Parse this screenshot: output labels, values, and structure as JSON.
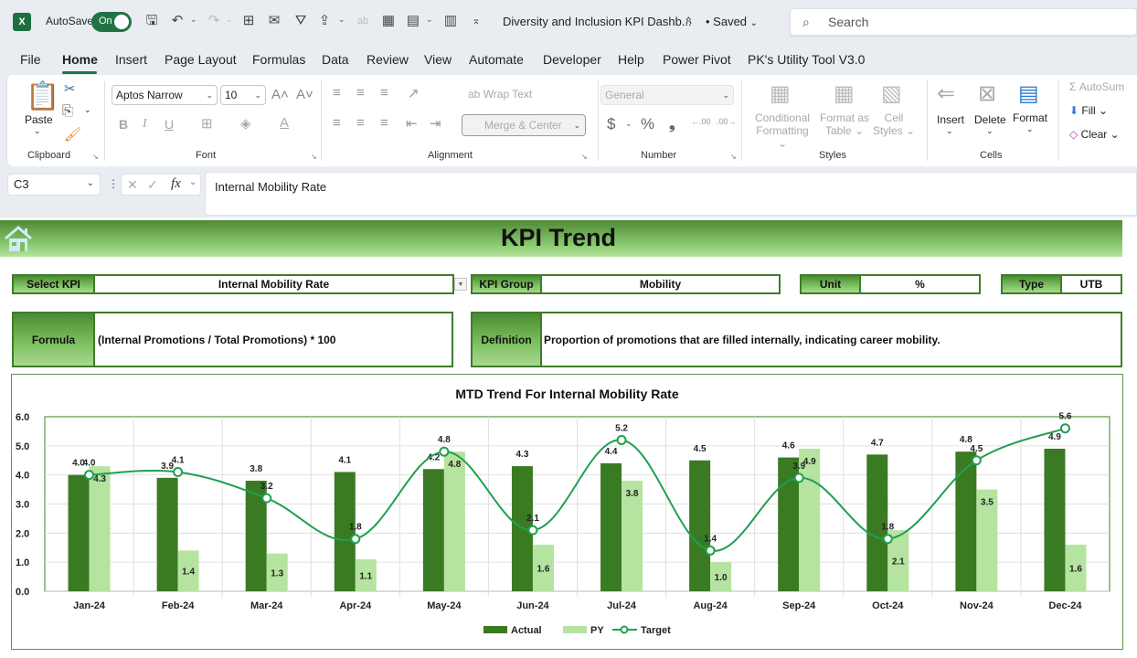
{
  "titlebar": {
    "app_icon": "excel-icon",
    "autosave_label": "AutoSave",
    "autosave_state": "On",
    "doc_title": "Diversity and Inclusion KPI Dashb...",
    "saved_label": "• Saved",
    "search_placeholder": "Search"
  },
  "menu": {
    "items": [
      "File",
      "Home",
      "Insert",
      "Page Layout",
      "Formulas",
      "Data",
      "Review",
      "View",
      "Automate",
      "Developer",
      "Help",
      "Power Pivot",
      "PK's Utility Tool V3.0"
    ],
    "active": "Home"
  },
  "ribbon": {
    "clipboard": {
      "paste_label": "Paste",
      "group_label": "Clipboard"
    },
    "font": {
      "font_name": "Aptos Narrow",
      "font_size": "10",
      "bold": "B",
      "italic": "I",
      "underline": "U",
      "group_label": "Font"
    },
    "alignment": {
      "wrap_text": "Wrap Text",
      "merge_center": "Merge & Center",
      "group_label": "Alignment"
    },
    "number": {
      "format": "General",
      "currency": "$",
      "percent": "%",
      "comma": "❟",
      "group_label": "Number"
    },
    "styles": {
      "conditional_1": "Conditional",
      "conditional_2": "Formatting",
      "format_table_1": "Format as",
      "format_table_2": "Table",
      "cell_styles_1": "Cell",
      "cell_styles_2": "Styles",
      "group_label": "Styles"
    },
    "cells": {
      "insert": "Insert",
      "delete": "Delete",
      "format": "Format",
      "group_label": "Cells"
    },
    "editing": {
      "autosum": "AutoSum",
      "fill": "Fill",
      "clear": "Clear"
    }
  },
  "formula_bar": {
    "cell_ref": "C3",
    "fx": "fx",
    "value": "Internal Mobility Rate"
  },
  "sheet": {
    "banner_title": "KPI Trend",
    "select_kpi_label": "Select KPI",
    "select_kpi_value": "Internal Mobility Rate",
    "kpi_group_label": "KPI Group",
    "kpi_group_value": "Mobility",
    "unit_label": "Unit",
    "unit_value": "%",
    "type_label": "Type",
    "type_value": "UTB",
    "formula_label": "Formula",
    "formula_value": "(Internal Promotions / Total Promotions) * 100",
    "definition_label": "Definition",
    "definition_value": "Proportion of promotions that are filled internally, indicating career mobility."
  },
  "colors": {
    "actual": "#3a7a22",
    "py": "#b5e3a0",
    "target": "#1fa050",
    "excel_green": "#217346"
  },
  "chart_data": {
    "type": "bar",
    "title": "MTD Trend For Internal Mobility Rate",
    "xlabel": "",
    "ylabel": "",
    "ylim": [
      0,
      6
    ],
    "yticks": [
      "0.0",
      "1.0",
      "2.0",
      "3.0",
      "4.0",
      "5.0",
      "6.0"
    ],
    "grid": true,
    "legend": "bottom-center",
    "categories": [
      "Jan-24",
      "Feb-24",
      "Mar-24",
      "Apr-24",
      "May-24",
      "Jun-24",
      "Jul-24",
      "Aug-24",
      "Sep-24",
      "Oct-24",
      "Nov-24",
      "Dec-24"
    ],
    "series": [
      {
        "name": "Actual",
        "kind": "bar",
        "values": [
          4.0,
          3.9,
          3.8,
          4.1,
          4.2,
          4.3,
          4.4,
          4.5,
          4.6,
          4.7,
          4.8,
          4.9
        ]
      },
      {
        "name": "PY",
        "kind": "bar",
        "values": [
          4.3,
          1.4,
          1.3,
          1.1,
          4.8,
          1.6,
          3.8,
          1.0,
          4.9,
          2.1,
          3.5,
          1.6
        ]
      },
      {
        "name": "Target",
        "kind": "line-smooth",
        "values": [
          4.0,
          4.1,
          3.2,
          1.8,
          4.8,
          2.1,
          5.2,
          1.4,
          3.9,
          1.8,
          4.5,
          5.6
        ]
      }
    ]
  }
}
